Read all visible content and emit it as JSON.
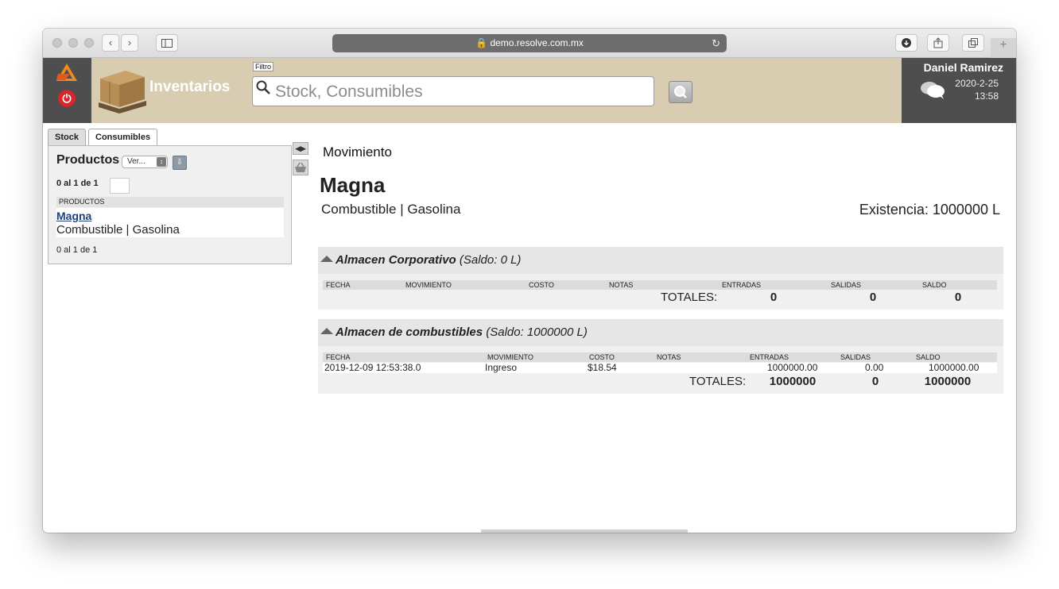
{
  "browser": {
    "url": "demo.resolve.com.mx",
    "back_glyph": "‹",
    "forward_glyph": "›"
  },
  "header": {
    "app_title": "Inventarios",
    "filter_label": "Filtro",
    "search_placeholder": "Stock, Consumibles",
    "user_name": "Daniel Ramirez",
    "date": "2020-2-25",
    "time": "13:58",
    "accent_color": "#d8ccb1"
  },
  "sidebar": {
    "tabs": [
      {
        "label": "Stock"
      },
      {
        "label": "Consumibles"
      }
    ],
    "title": "Productos",
    "view_select": "Ver...",
    "count_top": "0 al 1 de 1",
    "column_header": "PRODUCTOS",
    "items": [
      {
        "name": "Magna",
        "category": "Combustible | Gasolina"
      }
    ],
    "count_bottom": "0 al 1 de 1"
  },
  "main": {
    "section_label": "Movimiento",
    "product_name": "Magna",
    "product_category": "Combustible | Gasolina",
    "existence": "Existencia: 1000000 L",
    "warehouses": [
      {
        "name": "Almacen Corporativo",
        "balance": "(Saldo: 0 L)",
        "columns": [
          "FECHA",
          "MOVIMIENTO",
          "COSTO",
          "NOTAS",
          "ENTRADAS",
          "SALIDAS",
          "SALDO"
        ],
        "rows": [],
        "totals_label": "TOTALES:",
        "totals": {
          "entradas": "0",
          "salidas": "0",
          "saldo": "0"
        }
      },
      {
        "name": "Almacen de combustibles",
        "balance": "(Saldo: 1000000 L)",
        "columns": [
          "FECHA",
          "MOVIMIENTO",
          "COSTO",
          "NOTAS",
          "ENTRADAS",
          "SALIDAS",
          "SALDO"
        ],
        "rows": [
          {
            "fecha": "2019-12-09 12:53:38.0",
            "movimiento": "Ingreso",
            "costo": "$18.54",
            "notas": "",
            "entradas": "1000000.00",
            "salidas": "0.00",
            "saldo": "1000000.00"
          }
        ],
        "totals_label": "TOTALES:",
        "totals": {
          "entradas": "1000000",
          "salidas": "0",
          "saldo": "1000000"
        }
      }
    ]
  }
}
